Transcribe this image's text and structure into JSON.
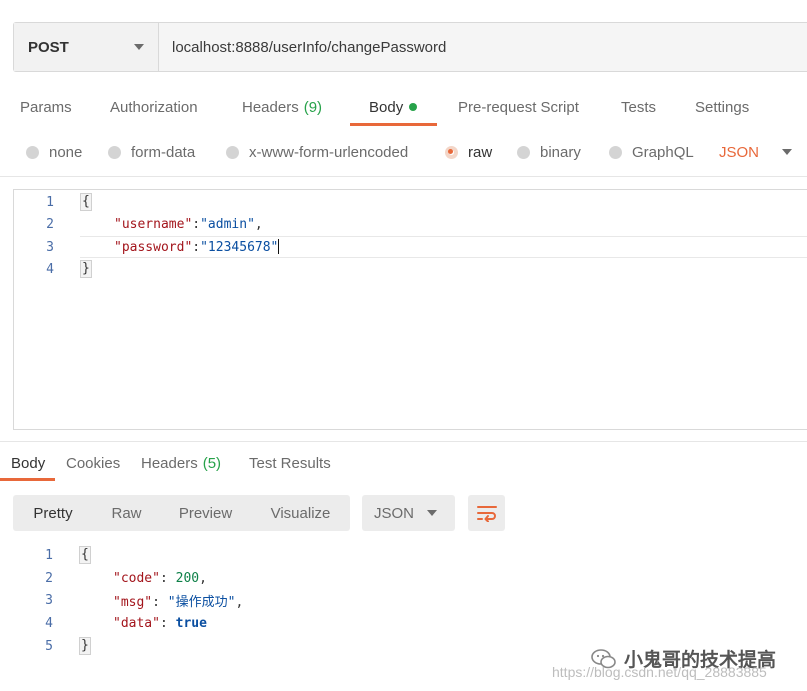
{
  "request": {
    "method": "POST",
    "url": "localhost:8888/userInfo/changePassword"
  },
  "request_tabs": [
    {
      "label": "Params"
    },
    {
      "label": "Authorization"
    },
    {
      "label": "Headers",
      "count": "(9)"
    },
    {
      "label": "Body"
    },
    {
      "label": "Pre-request Script"
    },
    {
      "label": "Tests"
    },
    {
      "label": "Settings"
    }
  ],
  "body_types": [
    "none",
    "form-data",
    "x-www-form-urlencoded",
    "raw",
    "binary",
    "GraphQL"
  ],
  "body_format": "JSON",
  "request_body": {
    "line_numbers": [
      "1",
      "2",
      "3",
      "4"
    ],
    "open_brace": "{",
    "close_brace": "}",
    "fields": [
      {
        "key": "\"username\"",
        "value": "\"admin\"",
        "trail": ","
      },
      {
        "key": "\"password\"",
        "value": "\"12345678\"",
        "trail": ""
      }
    ]
  },
  "response_tabs": [
    {
      "label": "Body"
    },
    {
      "label": "Cookies"
    },
    {
      "label": "Headers",
      "count": "(5)"
    },
    {
      "label": "Test Results"
    }
  ],
  "response_views": [
    "Pretty",
    "Raw",
    "Preview",
    "Visualize"
  ],
  "response_format": "JSON",
  "response_body": {
    "line_numbers": [
      "1",
      "2",
      "3",
      "4",
      "5"
    ],
    "open_brace": "{",
    "close_brace": "}",
    "fields": [
      {
        "key": "\"code\"",
        "value": "200",
        "trail": ","
      },
      {
        "key": "\"msg\"",
        "value": "\"操作成功\"",
        "trail": ","
      },
      {
        "key": "\"data\"",
        "value": "true",
        "trail": ""
      }
    ]
  },
  "colors": {
    "accent": "#e8683a",
    "green": "#27a24a",
    "json_key": "#a3151c",
    "json_string": "#0b4fa1"
  },
  "watermark": {
    "title": "小鬼哥的技术提高",
    "url": "https://blog.csdn.net/qq_28883885"
  }
}
